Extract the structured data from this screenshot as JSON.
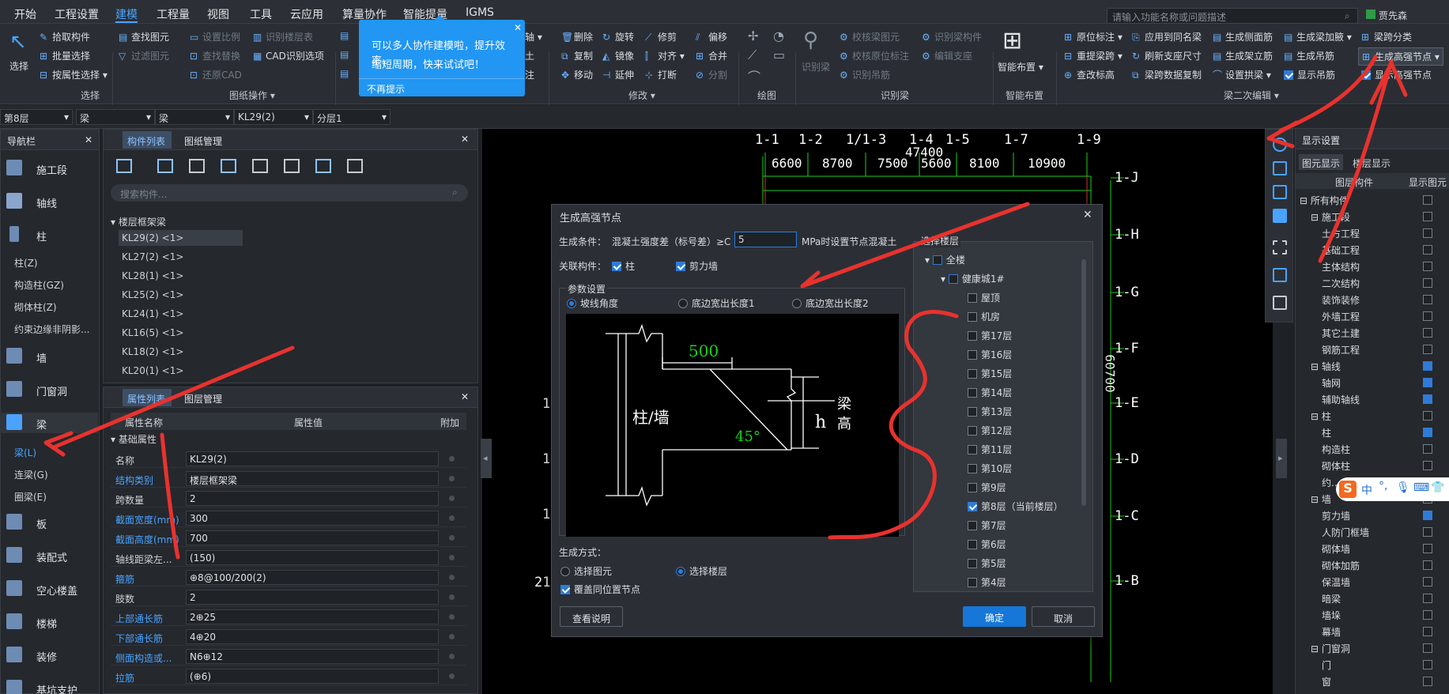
{
  "menu": [
    "开始",
    "工程设置",
    "建模",
    "工程量",
    "视图",
    "工具",
    "云应用",
    "算量协作",
    "智能提量",
    "IGMS"
  ],
  "menu_active": "建模",
  "search_placeholder": "请输入功能名称或问题描述",
  "user": "贾先森",
  "ribbon": {
    "select": "选择",
    "g1": [
      "拾取构件",
      "批量选择",
      "按属性选择"
    ],
    "g1_label": "选择",
    "g2a": [
      "查找图元",
      "过滤图元"
    ],
    "g2b": [
      "设置比例",
      "查找替换",
      "还原CAD"
    ],
    "g2c": [
      "识别楼层表",
      "CAD识别选项"
    ],
    "g2_label": "图纸操作",
    "g3": [
      "轴",
      "土",
      "注"
    ],
    "g4a": [
      "删除",
      "复制",
      "移动"
    ],
    "g4b": [
      "旋转",
      "镜像",
      "延伸"
    ],
    "g4c": [
      "修剪",
      "对齐",
      "打断"
    ],
    "g4d": [
      "偏移",
      "合并",
      "分割"
    ],
    "g4_label": "修改",
    "g5_label": "绘图",
    "g6a": "识别梁",
    "g6b": [
      "校核梁图元",
      "校核原位标注",
      "识别吊筋"
    ],
    "g6c": [
      "识别梁构件",
      "编辑支座"
    ],
    "g6_label": "识别梁",
    "g7": "智能布置",
    "g7_label": "智能布置",
    "g8a": [
      "原位标注",
      "重提梁跨",
      "查改标高"
    ],
    "g8b": [
      "应用到同名梁",
      "刷新支座尺寸",
      "梁跨数据复制"
    ],
    "g8c": [
      "生成侧面筋",
      "生成架立筋",
      "设置拱梁"
    ],
    "g8d": [
      "生成梁加腋",
      "生成吊筋",
      "显示吊筋"
    ],
    "g8e": [
      "梁跨分类",
      "生成高强节点",
      "显示高强节点"
    ],
    "g8_label": "梁二次编辑"
  },
  "tooltip": {
    "text1": "可以多人协作建模啦，提升效率，",
    "text2": "缩短周期，快来试试吧！",
    "dismiss": "不再提示"
  },
  "toolbar2": [
    "第8层",
    "梁",
    "梁",
    "KL29(2)",
    "分层1"
  ],
  "nav": {
    "title": "导航栏",
    "items": [
      "施工段",
      "轴线",
      "柱",
      "墙",
      "门窗洞",
      "梁",
      "板",
      "装配式",
      "空心楼盖",
      "楼梯",
      "装修",
      "基坑支护"
    ],
    "col_subs": [
      "柱(Z)",
      "构造柱(GZ)",
      "砌体柱(Z)",
      "约束边缘非阴影..."
    ],
    "beam_subs": [
      "梁(L)",
      "连梁(G)",
      "圈梁(E)"
    ]
  },
  "complist": {
    "tab1": "构件列表",
    "tab2": "图纸管理",
    "search": "搜索构件...",
    "group": "楼层框架梁",
    "items": [
      "KL29(2) <1>",
      "KL27(2) <1>",
      "KL28(1) <1>",
      "KL25(2) <1>",
      "KL24(1) <1>",
      "KL16(5) <1>",
      "KL18(2) <1>",
      "KL20(1) <1>"
    ]
  },
  "props": {
    "tab1": "属性列表",
    "tab2": "图层管理",
    "h1": "属性名称",
    "h2": "属性值",
    "h3": "附加",
    "group": "基础属性",
    "rows": [
      {
        "n": "名称",
        "v": "KL29(2)"
      },
      {
        "n": "结构类别",
        "v": "楼层框架梁"
      },
      {
        "n": "跨数量",
        "v": "2"
      },
      {
        "n": "截面宽度(mm)",
        "v": "300"
      },
      {
        "n": "截面高度(mm)",
        "v": "700"
      },
      {
        "n": "轴线距梁左...",
        "v": "(150)"
      },
      {
        "n": "箍筋",
        "v": "⊕8@100/200(2)"
      },
      {
        "n": "肢数",
        "v": "2"
      },
      {
        "n": "上部通长筋",
        "v": "2⊕25"
      },
      {
        "n": "下部通长筋",
        "v": "4⊕20"
      },
      {
        "n": "侧面构造或...",
        "v": "N6⊕12"
      },
      {
        "n": "拉筋",
        "v": "(⊕6)"
      }
    ]
  },
  "canvas": {
    "top_axes": [
      "1-1",
      "1-2",
      "1/1-3",
      "1-4",
      "1-5",
      "1-7",
      "1-9"
    ],
    "total": "47400",
    "spans": [
      "6600",
      "8700",
      "7500",
      "5600",
      "8100",
      "10900"
    ],
    "right_axes": [
      "1-J",
      "1-H",
      "1-G",
      "1-F",
      "1-E",
      "1-D",
      "1-C",
      "1-B"
    ],
    "right_dim": "60700",
    "left_nums": [
      "1",
      "1",
      "1",
      "21"
    ]
  },
  "dialog": {
    "title": "生成高强节点",
    "cond_label": "生成条件：",
    "cond_text": "混凝土强度差（标号差）≥C",
    "cond_value": "5",
    "cond_suffix": "MPa时设置节点混凝土",
    "assoc_label": "关联构件：",
    "assoc1": "柱",
    "assoc2": "剪力墙",
    "param_label": "参数设置",
    "radio1": "坡线角度",
    "radio2": "底边宽出长度1",
    "radio3": "底边宽出长度2",
    "diagram": {
      "dim": "500",
      "angle": "45°",
      "col": "柱/墙",
      "h": "h",
      "beam1": "梁",
      "beam2": "高"
    },
    "gen_label": "生成方式：",
    "gen1": "选择图元",
    "gen2": "选择楼层",
    "cover": "覆盖同位置节点",
    "floor_label": "选择楼层",
    "all": "全楼",
    "project": "健康城1#",
    "floors": [
      "屋顶",
      "机房",
      "第17层",
      "第16层",
      "第15层",
      "第14层",
      "第13层",
      "第12层",
      "第11层",
      "第10层",
      "第9层",
      "第8层（当前楼层）",
      "第7层",
      "第6层",
      "第5层",
      "第4层"
    ],
    "help": "查看说明",
    "ok": "确定",
    "cancel": "取消"
  },
  "rpanel": {
    "title": "显示设置",
    "tab1": "图元显示",
    "tab2": "楼层显示",
    "h1": "图层构件",
    "h2": "显示图元",
    "tree": [
      {
        "t": "所有构件",
        "l": 0,
        "c": false
      },
      {
        "t": "施工段",
        "l": 1,
        "c": false
      },
      {
        "t": "土方工程",
        "l": 2,
        "c": false
      },
      {
        "t": "基础工程",
        "l": 2,
        "c": false
      },
      {
        "t": "主体结构",
        "l": 2,
        "c": false
      },
      {
        "t": "二次结构",
        "l": 2,
        "c": false
      },
      {
        "t": "装饰装修",
        "l": 2,
        "c": false
      },
      {
        "t": "外墙工程",
        "l": 2,
        "c": false
      },
      {
        "t": "其它土建",
        "l": 2,
        "c": false
      },
      {
        "t": "钢筋工程",
        "l": 2,
        "c": false
      },
      {
        "t": "轴线",
        "l": 1,
        "c": true
      },
      {
        "t": "轴网",
        "l": 2,
        "c": true
      },
      {
        "t": "辅助轴线",
        "l": 2,
        "c": true
      },
      {
        "t": "柱",
        "l": 1,
        "c": false
      },
      {
        "t": "柱",
        "l": 2,
        "c": true
      },
      {
        "t": "构造柱",
        "l": 2,
        "c": false
      },
      {
        "t": "砌体柱",
        "l": 2,
        "c": false
      },
      {
        "t": "约...",
        "l": 2,
        "c": false
      },
      {
        "t": "墙",
        "l": 1,
        "c": false
      },
      {
        "t": "剪力墙",
        "l": 2,
        "c": true
      },
      {
        "t": "人防门框墙",
        "l": 2,
        "c": false
      },
      {
        "t": "砌体墙",
        "l": 2,
        "c": false
      },
      {
        "t": "砌体加筋",
        "l": 2,
        "c": false
      },
      {
        "t": "保温墙",
        "l": 2,
        "c": false
      },
      {
        "t": "暗梁",
        "l": 2,
        "c": false
      },
      {
        "t": "墙垛",
        "l": 2,
        "c": false
      },
      {
        "t": "幕墙",
        "l": 2,
        "c": false
      },
      {
        "t": "门窗洞",
        "l": 1,
        "c": false
      },
      {
        "t": "门",
        "l": 2,
        "c": false
      },
      {
        "t": "窗",
        "l": 2,
        "c": false
      }
    ]
  },
  "ime": "中",
  "colors": {
    "accent": "#2196f3",
    "annotation": "#e8322e",
    "green": "#19d219"
  }
}
